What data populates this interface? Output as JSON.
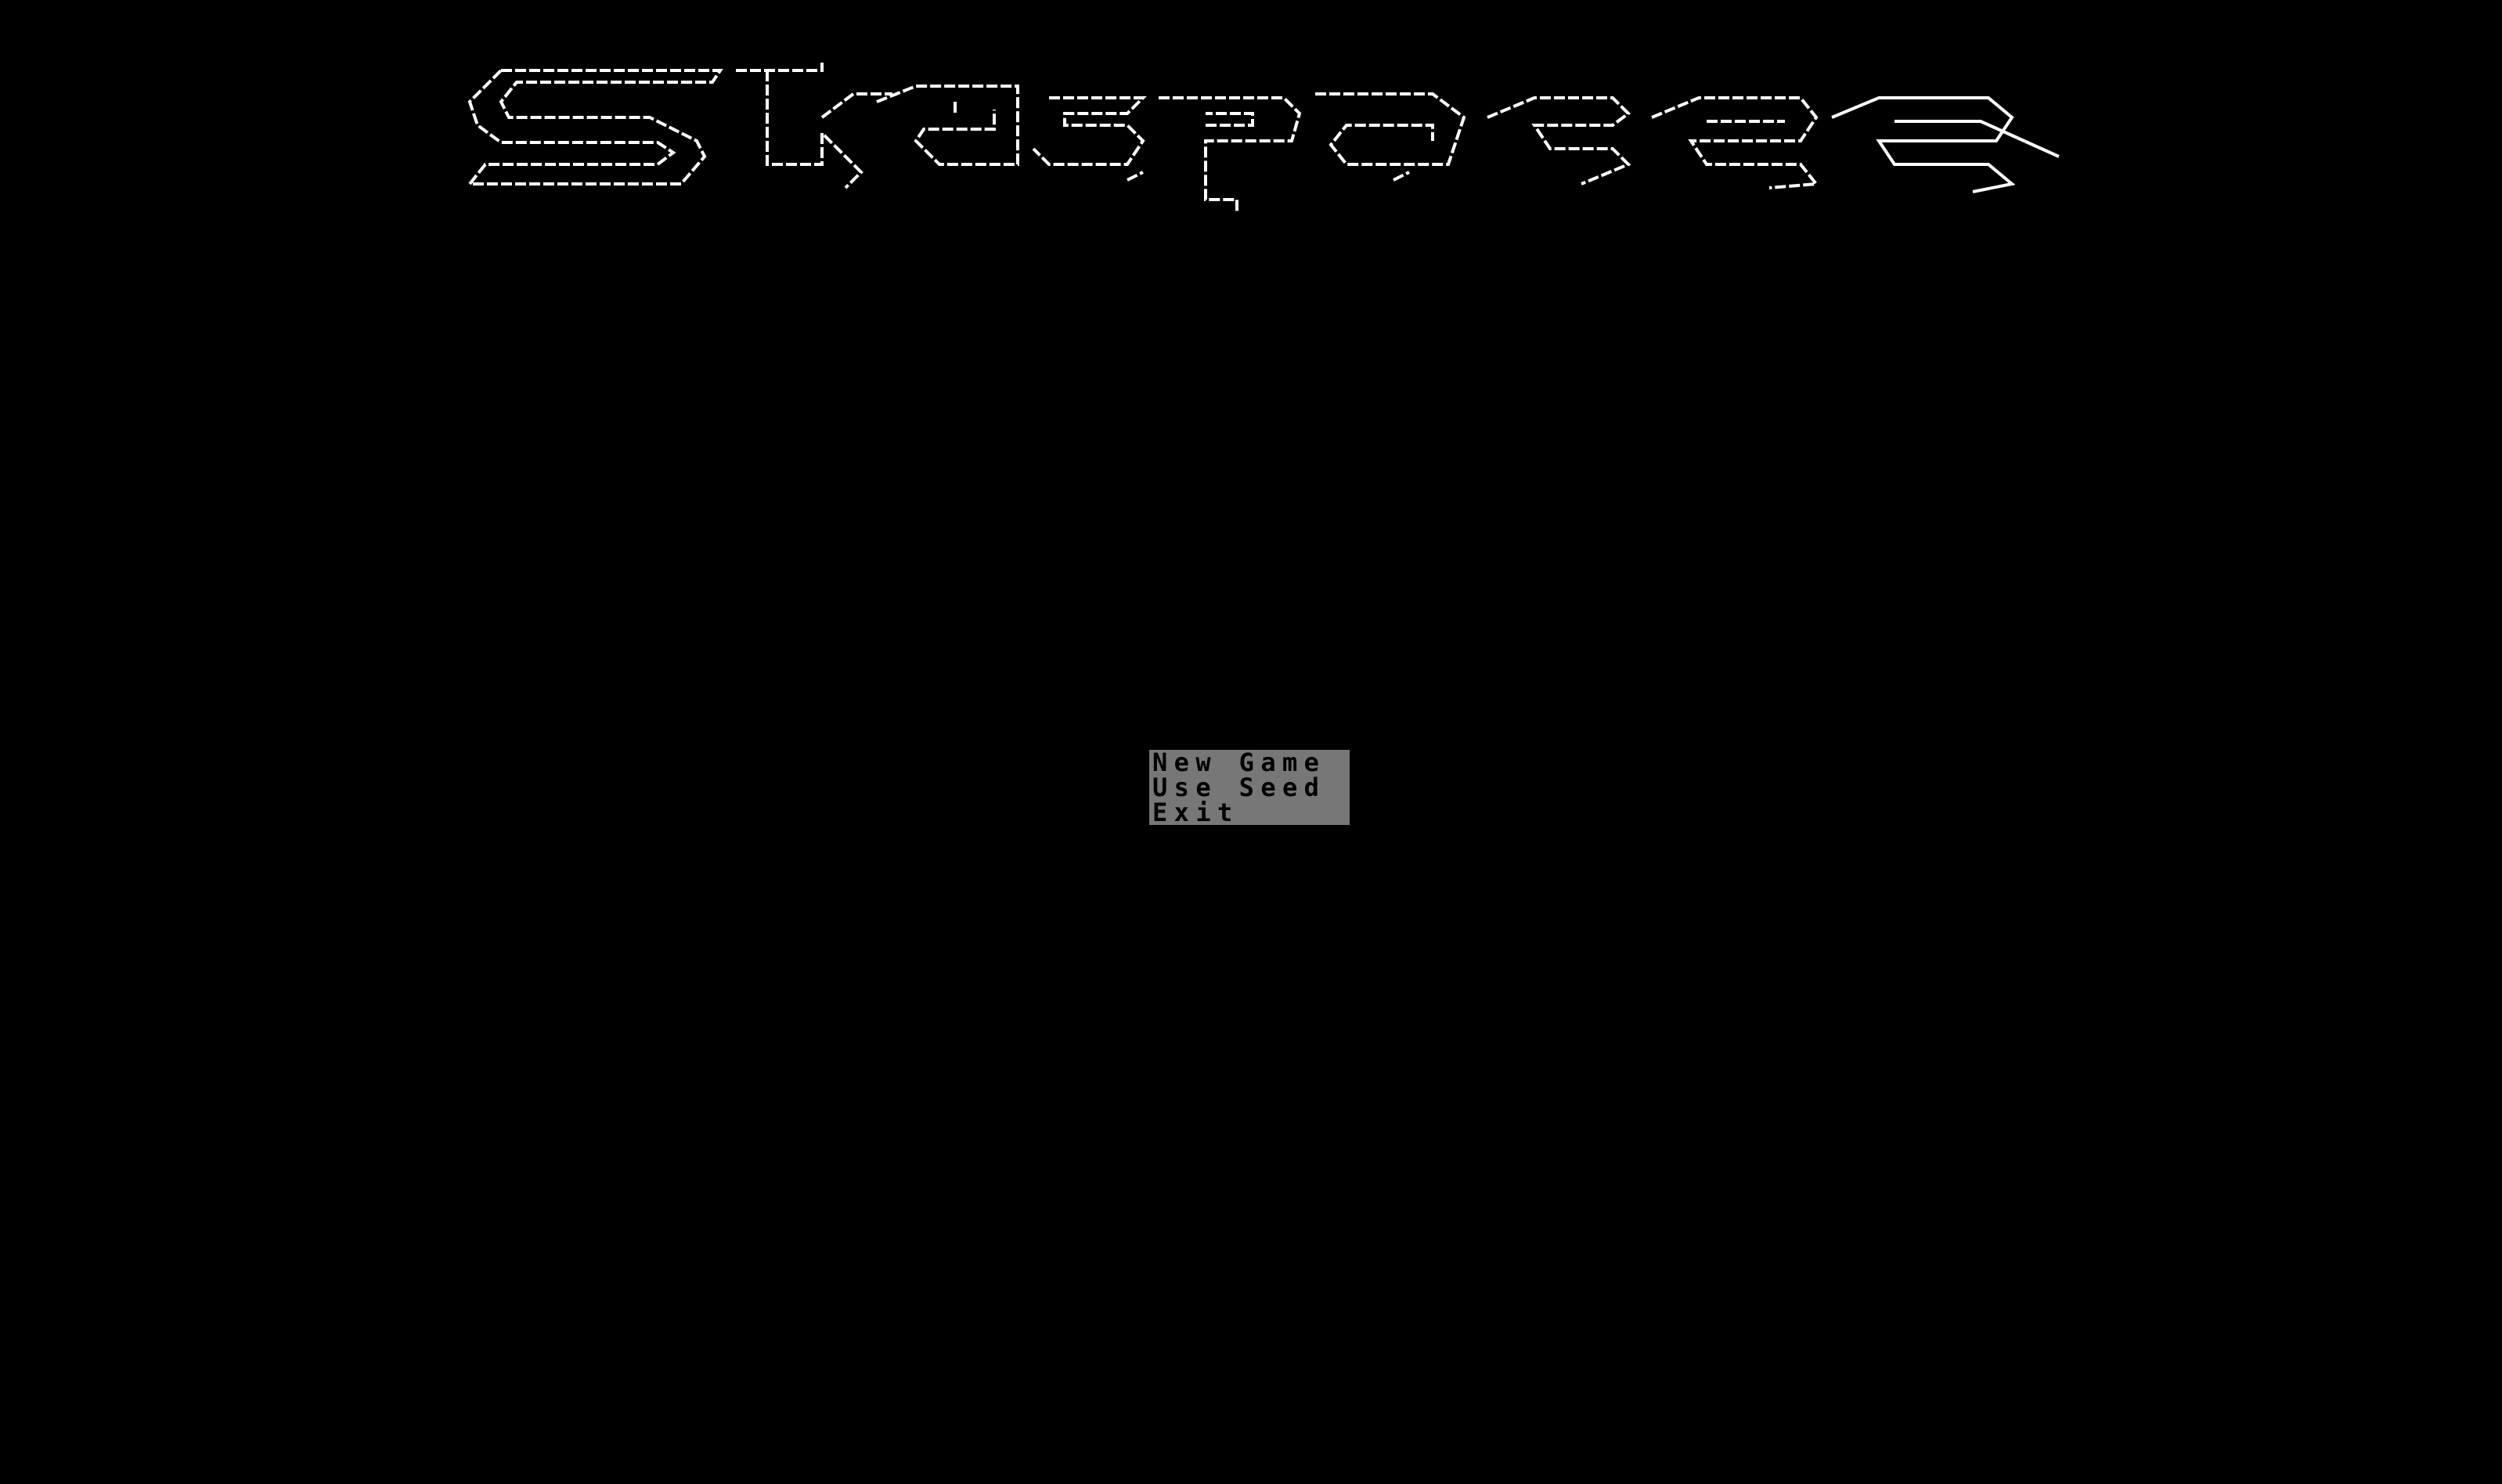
{
  "title": {
    "text": "Skyspace",
    "style": "ascii-art-outline"
  },
  "menu": {
    "items": [
      {
        "label": "New Game"
      },
      {
        "label": "Use Seed"
      },
      {
        "label": "Exit"
      }
    ],
    "background_color": "#777777",
    "text_color": "#000000"
  },
  "colors": {
    "background": "#000000",
    "title_stroke": "#ffffff"
  }
}
